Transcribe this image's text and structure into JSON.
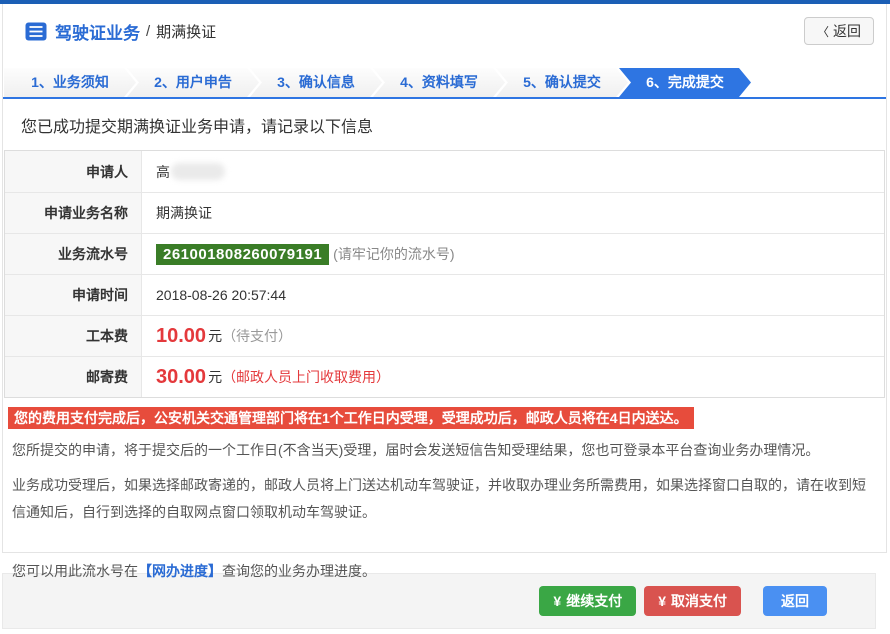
{
  "header": {
    "title_primary": "驾驶证业务",
    "title_separator": "/",
    "title_secondary": "期满换证",
    "back_chevron": "〈",
    "back_label": "返回"
  },
  "steps": {
    "items": [
      {
        "label": "1、业务须知",
        "active": false
      },
      {
        "label": "2、用户申告",
        "active": false
      },
      {
        "label": "3、确认信息",
        "active": false
      },
      {
        "label": "4、资料填写",
        "active": false
      },
      {
        "label": "5、确认提交",
        "active": false
      },
      {
        "label": "6、完成提交",
        "active": true
      }
    ]
  },
  "result": {
    "success_message": "您已成功提交期满换证业务申请，请记录以下信息"
  },
  "info": {
    "applicant": {
      "label": "申请人",
      "value": "高"
    },
    "business_name": {
      "label": "申请业务名称",
      "value": "期满换证"
    },
    "serial": {
      "label": "业务流水号",
      "number": "261001808260079191",
      "hint": "(请牢记你的流水号)"
    },
    "apply_time": {
      "label": "申请时间",
      "value": "2018-08-26 20:57:44"
    },
    "production_fee": {
      "label": "工本费",
      "amount": "10.00",
      "unit": "元",
      "note": "（待支付）"
    },
    "postage_fee": {
      "label": "邮寄费",
      "amount": "30.00",
      "unit": "元",
      "note": "（邮政人员上门收取费用）"
    }
  },
  "notes": {
    "alert": "您的费用支付完成后，公安机关交通管理部门将在1个工作日内受理，受理成功后，邮政人员将在4日内送达。",
    "p1": "您所提交的申请，将于提交后的一个工作日(不含当天)受理，届时会发送短信告知受理结果，您也可登录本平台查询业务办理情况。",
    "p2": "业务成功受理后，如果选择邮政寄递的，邮政人员将上门送达机动车驾驶证，并收取办理业务所需费用，如果选择窗口自取的，请在收到短信通知后，自行到选择的自取网点窗口领取机动车驾驶证。",
    "p3_prefix": "您可以用此流水号在",
    "p3_link": "【网办进度】",
    "p3_suffix": "查询您的业务办理进度。"
  },
  "footer": {
    "continue_pay": {
      "icon": "¥",
      "label": "继续支付"
    },
    "cancel_pay": {
      "icon": "¥",
      "label": "取消支付"
    },
    "back": {
      "label": "返回"
    }
  },
  "colors": {
    "topbar_blue": "#1b5fb5",
    "accent_blue": "#2a6bd4",
    "step_blue": "#2e75e2",
    "badge_green": "#3a7d27",
    "price_red": "#e4393c",
    "alert_red": "#e74c3c",
    "btn_green": "#3aa745",
    "btn_red": "#d9534f",
    "btn_blue": "#4a90f2"
  }
}
